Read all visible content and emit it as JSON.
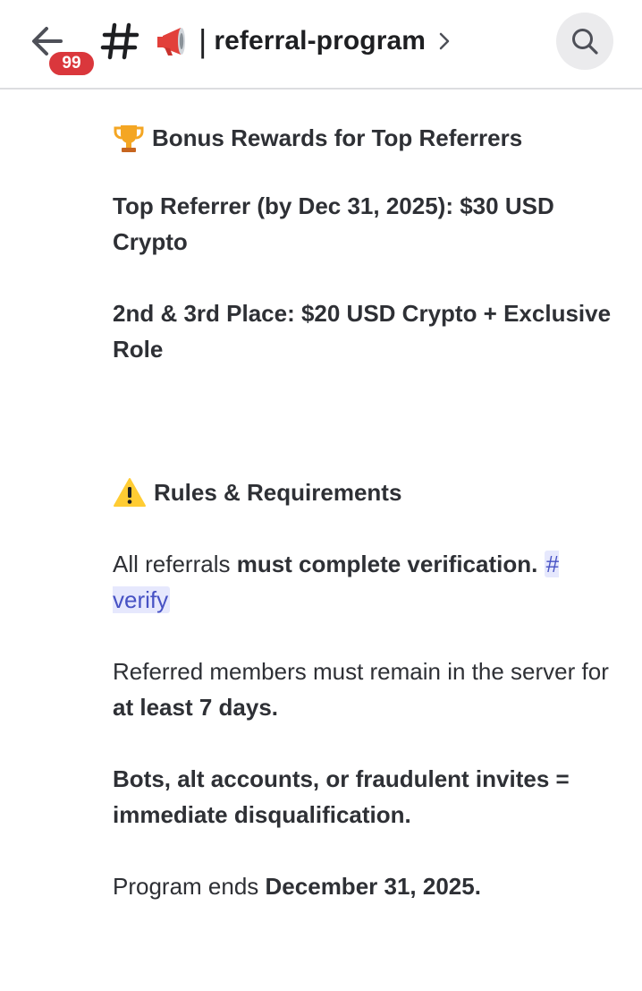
{
  "header": {
    "back_label": "Back",
    "badge_count": "99",
    "channel_emoji": "📢",
    "channel_separator": "|",
    "channel_name": "referral-program"
  },
  "icons": {
    "back": "arrow-left-icon",
    "channel": "hash-icon",
    "megaphone": "megaphone-icon",
    "chevron": "chevron-right-icon",
    "search": "search-icon",
    "trophy": "trophy-icon",
    "warning": "warning-icon"
  },
  "colors": {
    "badge": "#da373c",
    "mention_text": "#4752c4",
    "mention_bg": "#e6e8fd",
    "text": "#2e3035"
  },
  "message": {
    "bonus_heading": "Bonus Rewards for Top Referrers",
    "top_referrer": "Top Referrer (by Dec 31, 2025): $30 USD Crypto",
    "second_third": "2nd & 3rd Place: $20 USD Crypto + Exclusive Role",
    "rules_heading": "Rules & Requirements",
    "rule1_prefix": "All referrals ",
    "rule1_bold": "must complete verification.",
    "rule1_mention": "# verify",
    "rule2_prefix": "Referred members must remain in the server for ",
    "rule2_bold": "at least 7 days.",
    "rule3": "Bots, alt accounts, or fraudulent invites = immediate disqualification.",
    "rule4_prefix": "Program ends ",
    "rule4_bold": "December 31, 2025."
  }
}
